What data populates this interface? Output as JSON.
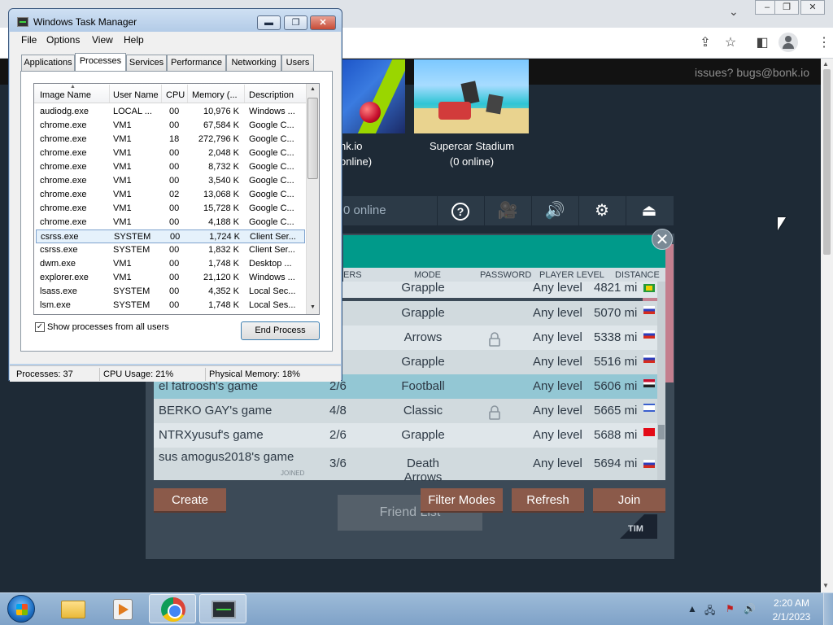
{
  "browser": {
    "window_controls": {
      "minimize": "–",
      "restore": "❐",
      "close": "✕"
    },
    "tabstrip_chevron": "⌄",
    "toolbar_icons": {
      "share": "⇪",
      "bookmark": "☆",
      "side_panel": "◧",
      "menu": "⋮"
    }
  },
  "game": {
    "issues_text": "issues? bugs@bonk.io",
    "maps": [
      {
        "name": "nk.io",
        "online": "online)"
      },
      {
        "name": "Supercar Stadium",
        "online": "(0 online)"
      }
    ],
    "online_count": "0 online",
    "iconbar": [
      {
        "icon": "help-icon",
        "glyph": "?"
      },
      {
        "icon": "camera-icon",
        "glyph": "🎥"
      },
      {
        "icon": "speaker-icon",
        "glyph": "🔊"
      },
      {
        "icon": "gear-icon",
        "glyph": "⚙"
      },
      {
        "icon": "exit-icon",
        "glyph": "⏏"
      }
    ],
    "lobby": {
      "close_glyph": "✕",
      "columns": {
        "players": "ERS",
        "mode": "MODE",
        "password": "PASSWORD",
        "level": "PLAYER LEVEL",
        "distance": "DISTANCE"
      },
      "rooms": [
        {
          "name": "",
          "players": "/6",
          "mode": "Grapple",
          "locked": false,
          "level": "Any level",
          "distance": "4821 mi",
          "flag": "br"
        },
        {
          "name": "",
          "players": "/6",
          "mode": "Grapple",
          "locked": false,
          "level": "Any level",
          "distance": "5070 mi",
          "flag": "ru"
        },
        {
          "name": "",
          "players": "/6",
          "mode": "Arrows",
          "locked": true,
          "level": "Any level",
          "distance": "5338 mi",
          "flag": "ru"
        },
        {
          "name": "",
          "players": "/6",
          "mode": "Grapple",
          "locked": false,
          "level": "Any level",
          "distance": "5516 mi",
          "flag": "ru"
        },
        {
          "name": "el fatroosh's game",
          "players": "2/6",
          "mode": "Football",
          "locked": false,
          "level": "Any level",
          "distance": "5606 mi",
          "flag": "eg"
        },
        {
          "name": "BERKO GAY's game",
          "players": "4/8",
          "mode": "Classic",
          "locked": true,
          "level": "Any level",
          "distance": "5665 mi",
          "flag": "il"
        },
        {
          "name": "NTRXyusuf's game",
          "players": "2/6",
          "mode": "Grapple",
          "locked": false,
          "level": "Any level",
          "distance": "5688 mi",
          "flag": "tr"
        },
        {
          "name": "sus amogus2018's game",
          "players": "3/6",
          "mode": "Death Arrows",
          "locked": false,
          "level": "Any level",
          "distance": "5694 mi",
          "flag": "ru"
        }
      ],
      "joined_tag": "JOINED",
      "buttons": {
        "create": "Create",
        "filter": "Filter Modes",
        "refresh": "Refresh",
        "join": "Join"
      },
      "friend_list": "Friend List",
      "logo": "TIM"
    }
  },
  "taskmgr": {
    "title": "Windows Task Manager",
    "window_buttons": {
      "minimize": "▬",
      "maximize": "❐",
      "close": "✕"
    },
    "menu": [
      "File",
      "Options",
      "View",
      "Help"
    ],
    "tabs": [
      "Applications",
      "Processes",
      "Services",
      "Performance",
      "Networking",
      "Users"
    ],
    "active_tab": "Processes",
    "columns": [
      "Image Name",
      "User Name",
      "CPU",
      "Memory (...",
      "Description"
    ],
    "processes": [
      [
        "audiodg.exe",
        "LOCAL ...",
        "00",
        "10,976 K",
        "Windows ..."
      ],
      [
        "chrome.exe",
        "VM1",
        "00",
        "67,584 K",
        "Google C..."
      ],
      [
        "chrome.exe",
        "VM1",
        "18",
        "272,796 K",
        "Google C..."
      ],
      [
        "chrome.exe",
        "VM1",
        "00",
        "2,048 K",
        "Google C..."
      ],
      [
        "chrome.exe",
        "VM1",
        "00",
        "8,732 K",
        "Google C..."
      ],
      [
        "chrome.exe",
        "VM1",
        "00",
        "3,540 K",
        "Google C..."
      ],
      [
        "chrome.exe",
        "VM1",
        "02",
        "13,068 K",
        "Google C..."
      ],
      [
        "chrome.exe",
        "VM1",
        "00",
        "15,728 K",
        "Google C..."
      ],
      [
        "chrome.exe",
        "VM1",
        "00",
        "4,188 K",
        "Google C..."
      ],
      [
        "csrss.exe",
        "SYSTEM",
        "00",
        "1,724 K",
        "Client Ser..."
      ],
      [
        "csrss.exe",
        "SYSTEM",
        "00",
        "1,832 K",
        "Client Ser..."
      ],
      [
        "dwm.exe",
        "VM1",
        "00",
        "1,748 K",
        "Desktop ..."
      ],
      [
        "explorer.exe",
        "VM1",
        "00",
        "21,120 K",
        "Windows ..."
      ],
      [
        "lsass.exe",
        "SYSTEM",
        "00",
        "4,352 K",
        "Local Sec..."
      ],
      [
        "lsm.exe",
        "SYSTEM",
        "00",
        "1,748 K",
        "Local Ses..."
      ]
    ],
    "selected_row": 9,
    "show_all_label": "Show processes from all users",
    "show_all_checked": "✓",
    "end_process": "End Process",
    "status": {
      "processes": "Processes: 37",
      "cpu": "CPU Usage: 21%",
      "memory": "Physical Memory: 18%"
    }
  },
  "taskbar": {
    "clock_time": "2:20 AM",
    "clock_date": "2/1/2023",
    "tray": {
      "arrow": "▲",
      "network": "🖧",
      "flag": "⚑",
      "volume": "🔊"
    }
  }
}
